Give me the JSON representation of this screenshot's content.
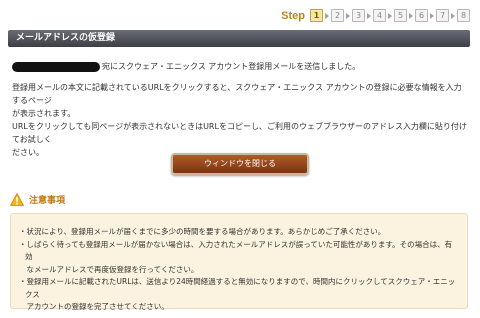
{
  "step_indicator": {
    "label": "Step",
    "steps": [
      "1",
      "2",
      "3",
      "4",
      "5",
      "6",
      "7",
      "8"
    ],
    "current": "1"
  },
  "title_bar": {
    "title": "メールアドレスの仮登録"
  },
  "message": {
    "email_sent": "宛にスクウェア・エニックス アカウント登録用メールを送信しました。",
    "instruction_1a": "登録用メールの本文に記載されているURLをクリックすると、スクウェア・エニックス アカウントの登録に必要な情報を入力するページ",
    "instruction_1b": "が表示されます。",
    "instruction_2a": "URLをクリックしても同ページが表示されないときはURLをコピーし、ご利用のウェブブラウザーのアドレス入力欄に貼り付けてお試しく",
    "instruction_2b": "ださい。"
  },
  "close_button": {
    "label": "ウィンドウを閉じる"
  },
  "notice": {
    "title": "注意事項",
    "items": [
      "・状況により、登録用メールが届くまでに多少の時間を要する場合があります。あらかじめご了承ください。",
      "・しばらく待っても登録用メールが届かない場合は、入力されたメールアドレスが誤っていた可能性があります。その場合は、有効",
      "　なメールアドレスで再度仮登録を行ってください。",
      "・登録用メールに記載されたURLは、送信より24時間経過すると無効になりますので、時間内にクリックしてスクウェア・エニックス",
      "　アカウントの登録を完了させてください。"
    ]
  },
  "colors": {
    "title_bar": "#4a4c55",
    "button": "#9a4719",
    "notice_title": "#c07a12",
    "notice_bg": "#fbf3df"
  },
  "icons": {
    "warning": "warning-icon"
  }
}
